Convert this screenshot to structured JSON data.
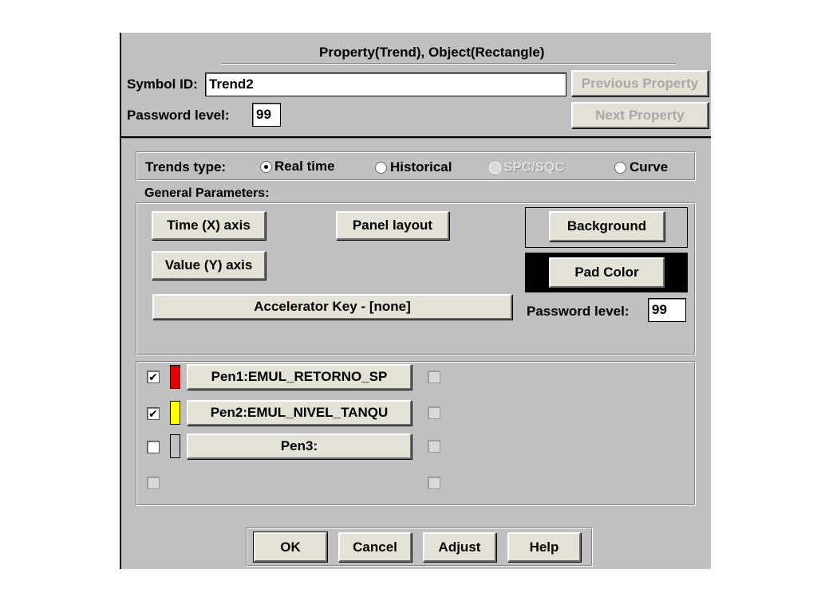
{
  "dialog": {
    "title": "Property(Trend), Object(Rectangle)"
  },
  "header": {
    "symbol_id_label": "Symbol ID:",
    "symbol_id_value": "Trend2",
    "password_label": "Password level:",
    "password_value": "99",
    "previous_property_label": "Previous Property",
    "next_property_label": "Next Property"
  },
  "trends_type": {
    "label": "Trends type:",
    "options": [
      {
        "label": "Real time",
        "selected": true,
        "enabled": true
      },
      {
        "label": "Historical",
        "selected": false,
        "enabled": true
      },
      {
        "label": "SPC/SQC",
        "selected": false,
        "enabled": false
      },
      {
        "label": "Curve",
        "selected": false,
        "enabled": true
      }
    ]
  },
  "general": {
    "label": "General Parameters:",
    "time_axis_label": "Time (X) axis",
    "panel_layout_label": "Panel  layout",
    "value_axis_label": "Value (Y) axis",
    "background_label": "Background",
    "pad_color_label": "Pad Color",
    "pad_color_color": "#000000",
    "accelerator_label": "Accelerator Key - [none]",
    "password_label": "Password level:",
    "password_value": "99"
  },
  "pens": [
    {
      "label": "Pen1:EMUL_RETORNO_SP",
      "check": "✔",
      "color": "#e00000"
    },
    {
      "label": "Pen2:EMUL_NIVEL_TANQU",
      "check": "✔",
      "color": "#ffff00"
    },
    {
      "label": "Pen3:",
      "check": "",
      "color": "#c0c0c0"
    }
  ],
  "footer": {
    "ok_label": "OK",
    "cancel_label": "Cancel",
    "adjust_label": "Adjust",
    "help_label": "Help"
  }
}
